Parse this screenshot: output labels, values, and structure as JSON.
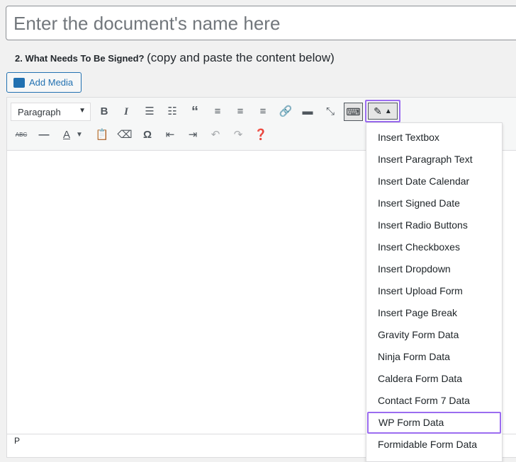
{
  "title_input": {
    "placeholder": "Enter the document's name here"
  },
  "step": {
    "label": "2. What Needs To Be Signed?",
    "hint": "(copy and paste the content below)"
  },
  "add_media": "Add Media",
  "format_select": "Paragraph",
  "status_path": "P",
  "menu": [
    "Insert Textbox",
    "Insert Paragraph Text",
    "Insert Date Calendar",
    "Insert Signed Date",
    "Insert Radio Buttons",
    "Insert Checkboxes",
    "Insert Dropdown",
    "Insert Upload Form",
    "Insert Page Break",
    "Gravity Form Data",
    "Ninja Form Data",
    "Caldera Form Data",
    "Contact Form 7 Data",
    "WP Form Data",
    "Formidable Form Data"
  ],
  "accent": "#9b6cf0"
}
